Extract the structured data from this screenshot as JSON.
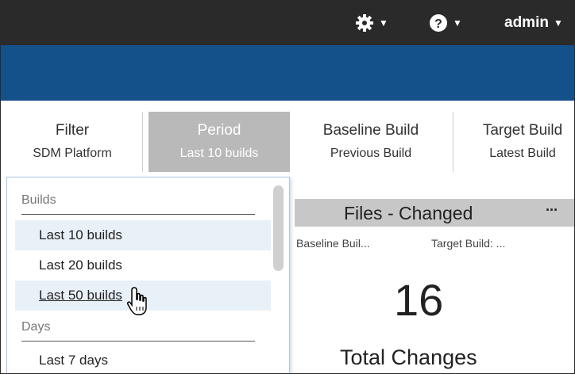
{
  "topbar": {
    "settings_icon": "gear-icon",
    "help_icon": "question-circle-icon",
    "user_label": "admin"
  },
  "filters": [
    {
      "label": "Filter",
      "value": "SDM Platform"
    },
    {
      "label": "Period",
      "value": "Last 10 builds"
    },
    {
      "label": "Baseline Build",
      "value": "Previous Build"
    },
    {
      "label": "Target Build",
      "value": "Latest Build"
    }
  ],
  "dropdown": {
    "sections": [
      {
        "title": "Builds",
        "items": [
          "Last 10 builds",
          "Last 20 builds",
          "Last 50 builds"
        ]
      },
      {
        "title": "Days",
        "items": [
          "Last 7 days"
        ]
      }
    ],
    "selected": "Last 10 builds",
    "hovered": "Last 50 builds"
  },
  "card": {
    "title": "Files - Changed",
    "more": "···",
    "baseline_sub": "Baseline Buil...",
    "target_sub": "Target Build: ...",
    "value": "16",
    "label": "Total Changes"
  },
  "colors": {
    "topbar": "#2a2a2a",
    "band": "#14508a",
    "active_filter": "#b9b9b9",
    "dropdown_highlight": "#e8f0f8"
  }
}
